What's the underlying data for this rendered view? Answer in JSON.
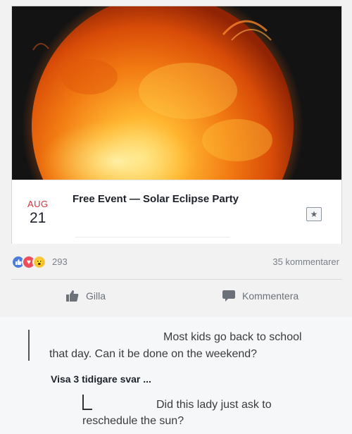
{
  "event": {
    "month": "AUG",
    "day": "21",
    "title": "Free Event — Solar Eclipse Party",
    "save_icon": "star-bookmark-icon"
  },
  "stats": {
    "reaction_icons": [
      "like-icon",
      "love-icon",
      "wow-icon"
    ],
    "reaction_count": "293",
    "comment_count": "35 kommentarer"
  },
  "actions": {
    "like_label": "Gilla",
    "comment_label": "Kommentera"
  },
  "comments": {
    "first_line1": "Most kids go back to school",
    "first_line2": "that day. Can it be done on the weekend?",
    "view_more": "Visa 3 tidigare svar ...",
    "reply_line1": "Did this lady just ask to",
    "reply_line2": "reschedule the sun?"
  },
  "colors": {
    "month_red": "#d3363f",
    "like_blue": "#4f7ddb",
    "love_red": "#ee4d5a",
    "wow_yellow": "#f7c944"
  }
}
